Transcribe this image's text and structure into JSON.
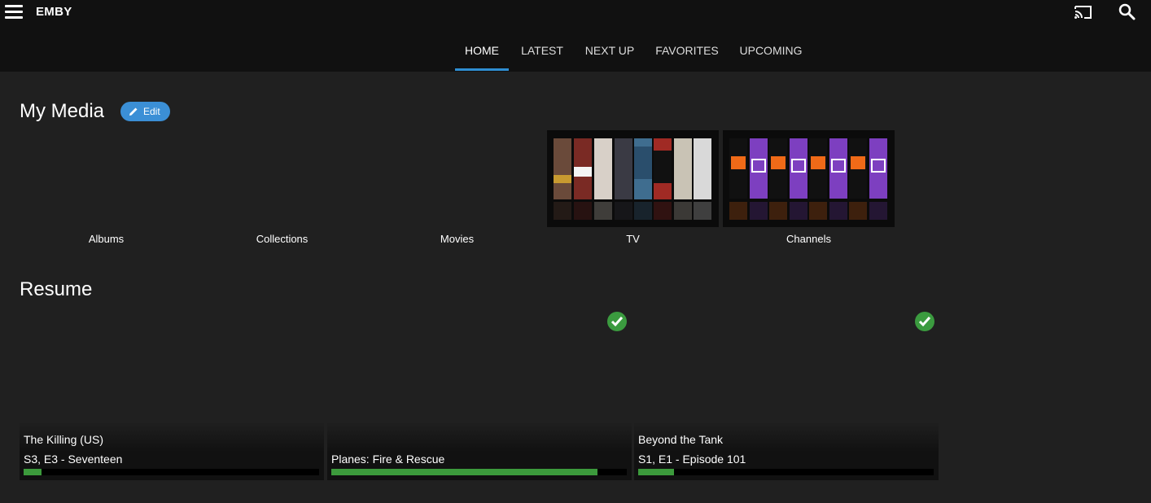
{
  "app": {
    "title": "EMBY"
  },
  "header": {
    "menu_icon": "hamburger-menu-icon",
    "cast_icon": "cast-icon",
    "search_icon": "search-icon"
  },
  "tabs": [
    {
      "label": "HOME",
      "active": true
    },
    {
      "label": "LATEST",
      "active": false
    },
    {
      "label": "NEXT UP",
      "active": false
    },
    {
      "label": "FAVORITES",
      "active": false
    },
    {
      "label": "UPCOMING",
      "active": false
    }
  ],
  "my_media": {
    "title": "My Media",
    "edit_label": "Edit",
    "libraries": [
      {
        "label": "Albums"
      },
      {
        "label": "Collections"
      },
      {
        "label": "Movies"
      },
      {
        "label": "TV"
      },
      {
        "label": "Channels"
      }
    ]
  },
  "resume": {
    "title": "Resume",
    "items": [
      {
        "title": "The Killing (US)",
        "subtitle": "S3, E3 - Seventeen",
        "progress_pct": 6,
        "played": false
      },
      {
        "title": "",
        "subtitle": "Planes: Fire & Rescue",
        "progress_pct": 90,
        "played": true
      },
      {
        "title": "Beyond the Tank",
        "subtitle": "S1, E1 - Episode 101",
        "progress_pct": 12,
        "played": true
      }
    ]
  },
  "colors": {
    "accent": "#2f8ed2",
    "edit_button": "#3b8fd6",
    "progress": "#3c9a3c",
    "played_badge": "#3b9b3f",
    "channels_purple": "#7d3fc0",
    "channels_orange": "#f06a18"
  }
}
